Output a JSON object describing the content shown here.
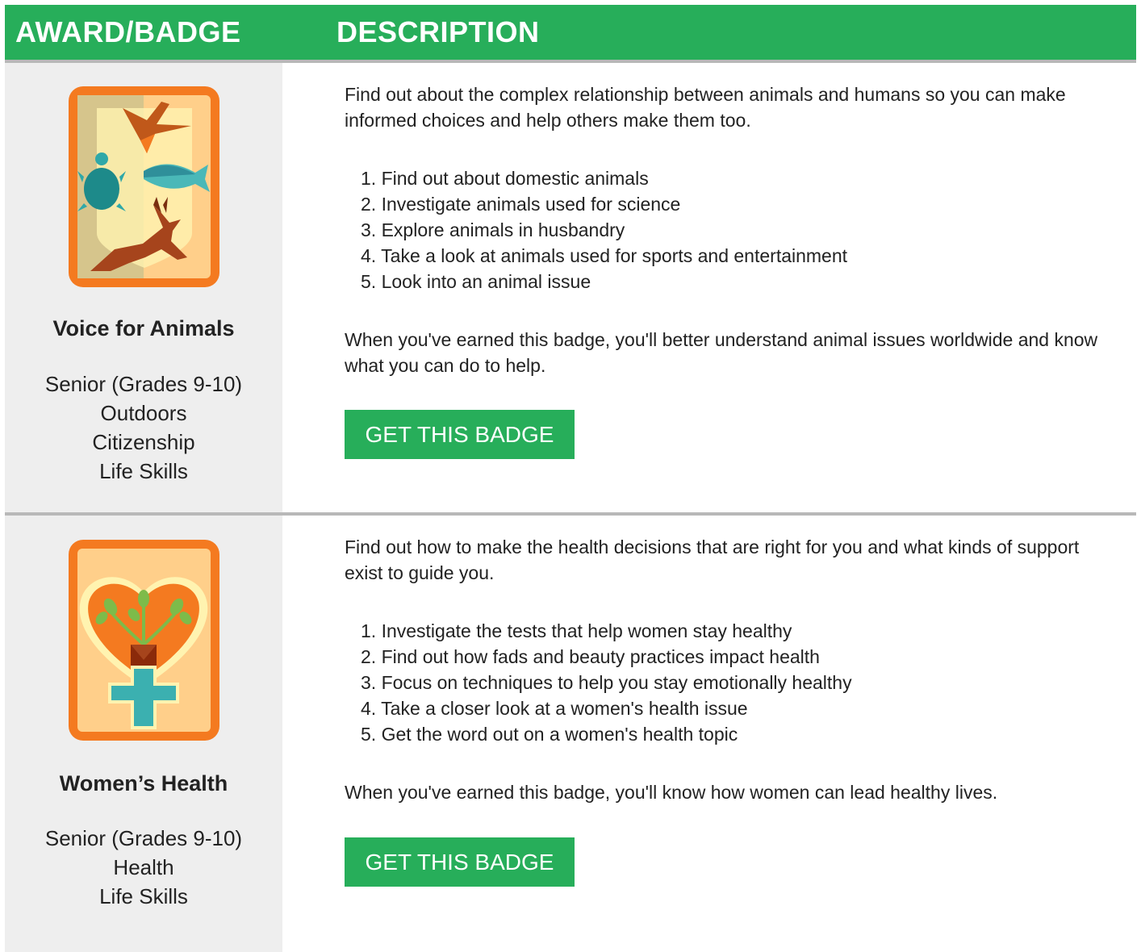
{
  "header": {
    "col1": "AWARD/BADGE",
    "col2": "DESCRIPTION"
  },
  "colors": {
    "accent": "#27ae5a",
    "divider": "#b8b8b8",
    "left_column_bg": "#eeeeee"
  },
  "badges": [
    {
      "icon": "voice-for-animals-badge-icon",
      "name": "Voice for Animals",
      "meta": [
        "Senior (Grades 9-10)",
        "Outdoors",
        "Citizenship",
        "Life Skills"
      ],
      "intro": "Find out about the complex relationship between animals and humans so you can make informed choices and help others make them too.",
      "steps": [
        "1. Find out about domestic animals",
        "2. Investigate animals used for science",
        "3. Explore animals in husbandry",
        "4. Take a look at animals used for sports and entertainment",
        "5. Look into an animal issue"
      ],
      "outro": "When you've earned this badge, you'll better understand animal issues worldwide and know what you can do to help.",
      "cta": "GET THIS BADGE"
    },
    {
      "icon": "womens-health-badge-icon",
      "name": "Women’s Health",
      "meta": [
        "Senior (Grades 9-10)",
        "Health",
        "Life Skills"
      ],
      "intro": "Find out how to make the health decisions that are right for you and what kinds of support exist to guide you.",
      "steps": [
        "1. Investigate the tests that help women stay healthy",
        "2. Find out how fads and beauty practices impact health",
        "3. Focus on techniques to help you stay emotionally healthy",
        "4. Take a closer look at a women's health issue",
        "5. Get the word out on a women's health topic"
      ],
      "outro": "When you've earned this badge, you'll know how women can lead healthy lives.",
      "cta": "GET THIS BADGE"
    }
  ]
}
